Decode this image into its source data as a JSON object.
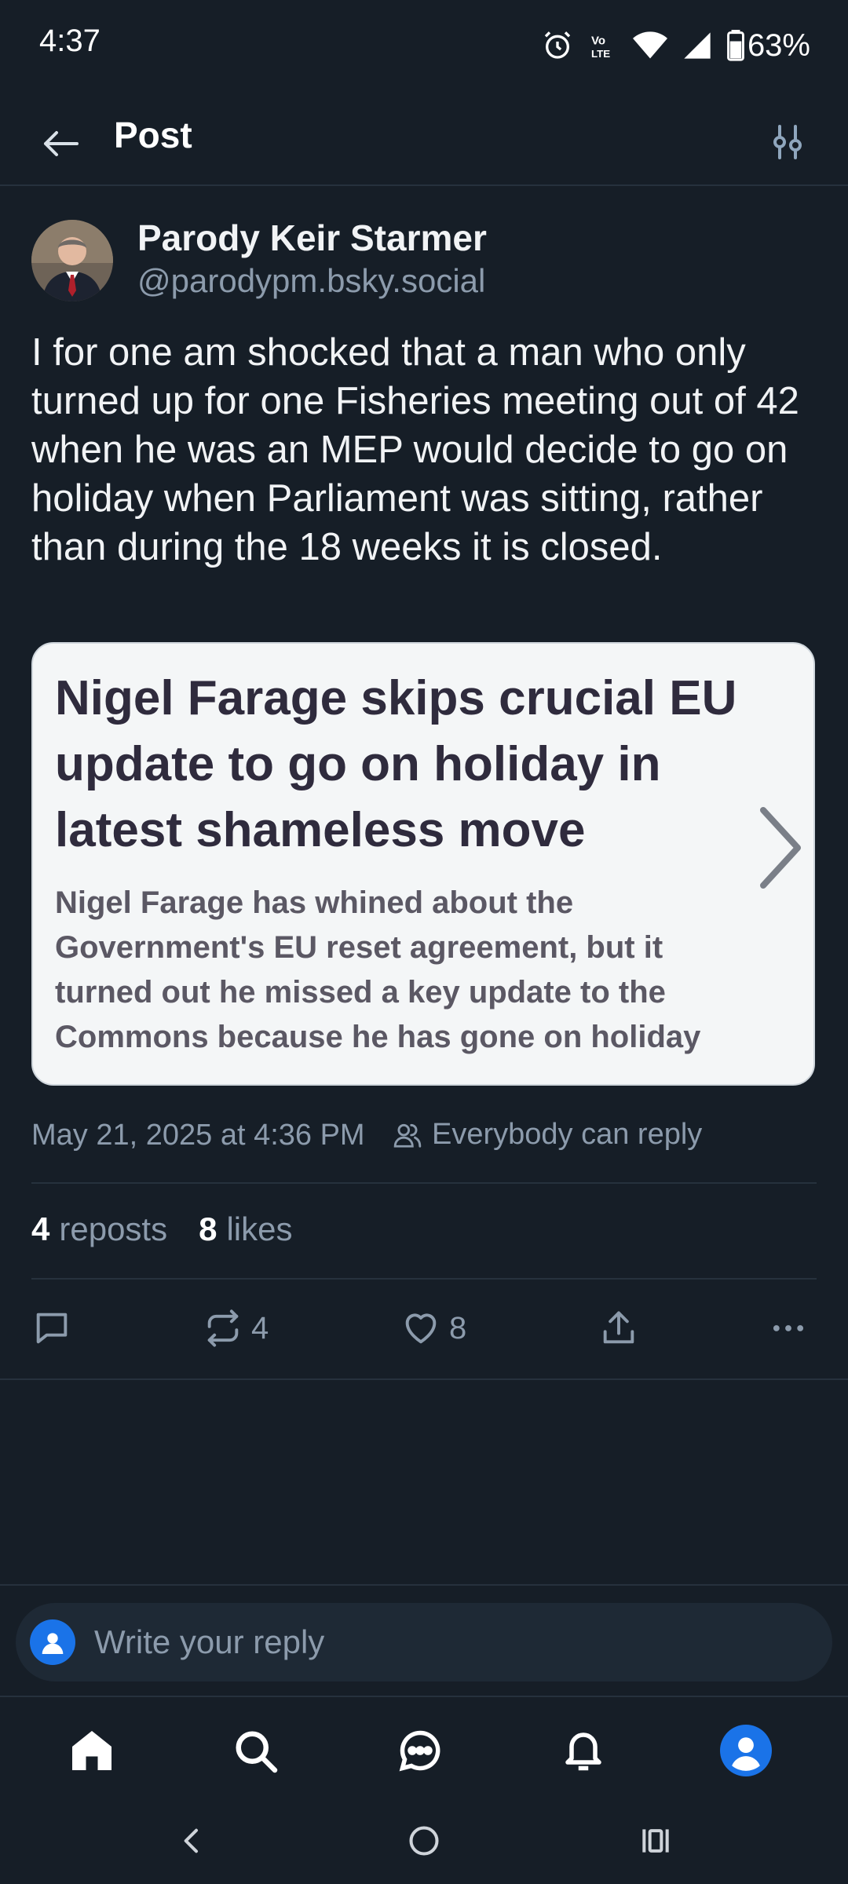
{
  "status_bar": {
    "time": "4:37",
    "battery": "63%",
    "network_badge": "VoLTE",
    "icons": [
      "alarm-icon",
      "volte-icon",
      "wifi-icon",
      "signal-icon",
      "battery-icon"
    ]
  },
  "header": {
    "title": "Post",
    "back_icon": "arrow-left-icon",
    "filter_icon": "sliders-icon"
  },
  "post": {
    "author_name": "Parody Keir Starmer",
    "author_handle": "@parodypm.bsky.social",
    "text": "I for one am shocked that a man who only turned up for one Fisheries meeting out of 42 when he was an MEP would decide to go on holiday when Parliament was sitting, rather than during the 18 weeks it is closed.",
    "link_card": {
      "title": "Nigel Farage skips crucial EU update to go on holiday in latest shameless move",
      "description": "Nigel Farage has whined about the Government's EU reset agreement, but it turned out he missed a key update to the Commons because he has gone on holiday"
    },
    "timestamp": "May 21, 2025 at 4:36 PM",
    "reply_setting": "Everybody can reply",
    "stats": {
      "reposts_count": "4",
      "reposts_label": "reposts",
      "likes_count": "8",
      "likes_label": "likes"
    },
    "actions": {
      "repost_count": "4",
      "like_count": "8"
    }
  },
  "reply_composer": {
    "placeholder": "Write your reply"
  },
  "bottom_nav": {
    "items": [
      "home-icon",
      "search-icon",
      "chat-icon",
      "bell-icon",
      "profile-icon"
    ]
  },
  "colors": {
    "background": "#161e27",
    "muted_text": "#8c9bac",
    "accent": "#1a73e8",
    "card_background": "#f4f6f7",
    "card_title": "#2f2b3d"
  }
}
